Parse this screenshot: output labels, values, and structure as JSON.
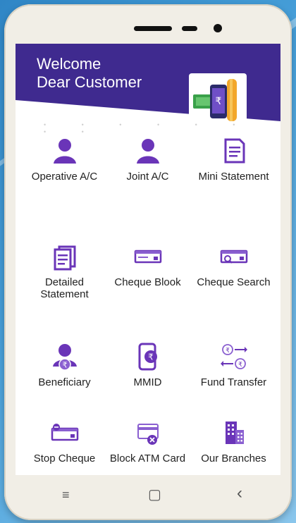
{
  "banner": {
    "line1": "Welcome",
    "line2": "Dear Customer"
  },
  "colors": {
    "brand": "#3f2a8f",
    "icon": "#6a35b8",
    "icon_light": "#8a5fd0"
  },
  "menu": [
    {
      "label": "Operative A/C",
      "icon": "user-icon"
    },
    {
      "label": "Joint A/C",
      "icon": "user-icon"
    },
    {
      "label": "Mini Statement",
      "icon": "document-icon"
    },
    {
      "label": "Detailed\nStatement",
      "icon": "statement-icon"
    },
    {
      "label": "Cheque Blook",
      "icon": "cheque-icon"
    },
    {
      "label": "Cheque Search",
      "icon": "cheque-search-icon"
    },
    {
      "label": "Beneficiary",
      "icon": "beneficiary-icon"
    },
    {
      "label": "MMID",
      "icon": "mobile-rupee-icon"
    },
    {
      "label": "Fund Transfer",
      "icon": "transfer-icon"
    },
    {
      "label": "Stop Cheque",
      "icon": "stop-cheque-icon"
    },
    {
      "label": "Block ATM Card",
      "icon": "block-card-icon"
    },
    {
      "label": "Our Branches",
      "icon": "building-icon"
    }
  ],
  "nav": {
    "menu": "≡",
    "home": "▢",
    "back": "‹"
  }
}
